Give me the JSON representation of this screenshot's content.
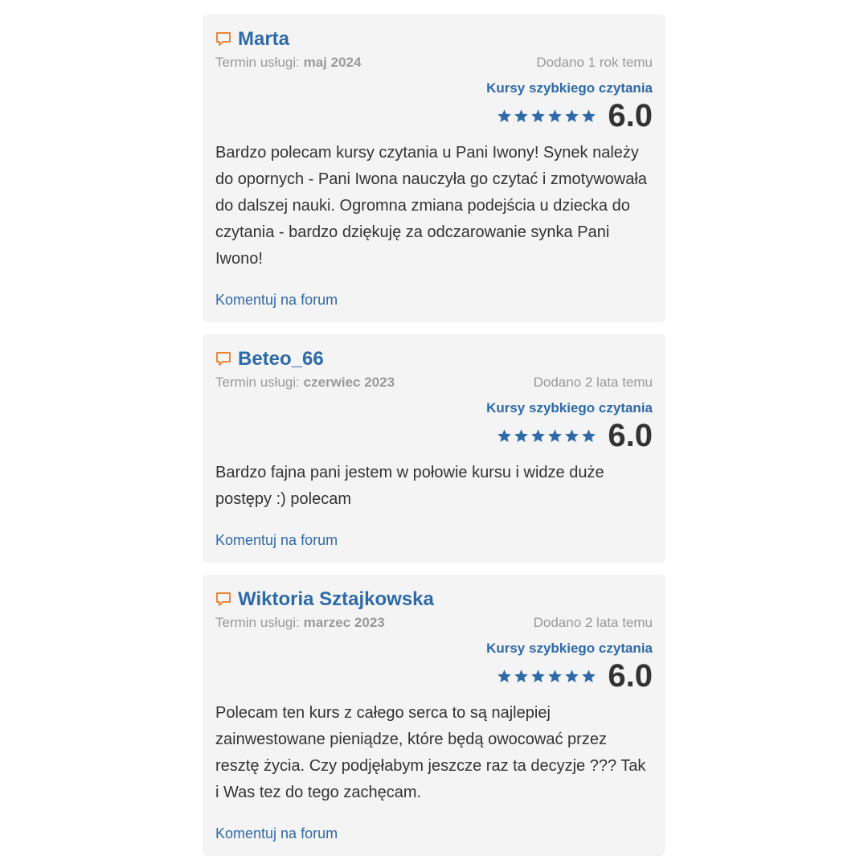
{
  "labels": {
    "term_prefix": "Termin usługi:",
    "comment_link": "Komentuj na forum"
  },
  "colors": {
    "accent": "#2f6aa8",
    "icon": "#e8883a",
    "card_bg": "#f4f4f4"
  },
  "reviews": [
    {
      "author": "Marta",
      "term": "maj 2024",
      "added": "Dodano 1 rok temu",
      "course": "Kursy szybkiego czytania",
      "stars": 6,
      "score": "6.0",
      "text": "Bardzo polecam kursy czytania u Pani Iwony! Synek należy do opornych - Pani Iwona nauczyła go czytać i zmotywowała do dalszej nauki. Ogromna zmiana podejścia u dziecka do czytania - bardzo dziękuję za odczarowanie synka Pani Iwono!"
    },
    {
      "author": "Beteo_66",
      "term": "czerwiec 2023",
      "added": "Dodano 2 lata temu",
      "course": "Kursy szybkiego czytania",
      "stars": 6,
      "score": "6.0",
      "text": "Bardzo fajna pani jestem w połowie kursu i widze duże postępy :) polecam"
    },
    {
      "author": "Wiktoria Sztajkowska",
      "term": "marzec 2023",
      "added": "Dodano 2 lata temu",
      "course": "Kursy szybkiego czytania",
      "stars": 6,
      "score": "6.0",
      "text": "Polecam ten kurs z całego serca to są najlepiej zainwestowane pieniądze, które będą owocować przez resztę życia. Czy podjęłabym jeszcze raz ta decyzje ??? Tak i Was tez do tego zachęcam."
    }
  ]
}
